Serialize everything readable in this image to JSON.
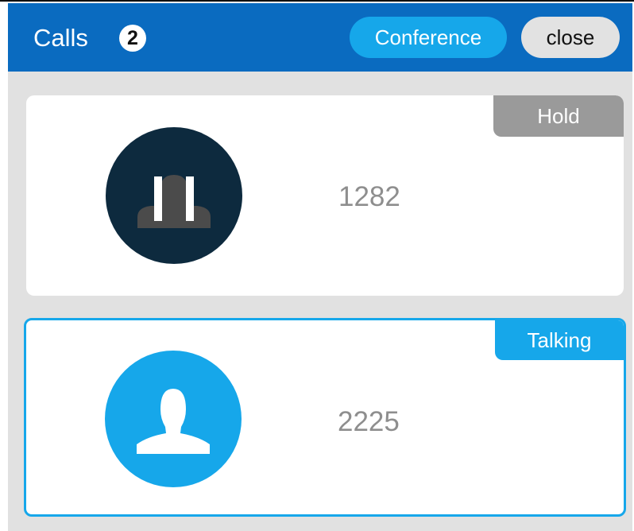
{
  "header": {
    "title": "Calls",
    "count": "2",
    "conference_label": "Conference",
    "close_label": "close"
  },
  "calls": [
    {
      "number": "1282",
      "status": "Hold",
      "status_color": "#9a9a9a",
      "avatar_icon": "paused-contact-icon"
    },
    {
      "number": "2225",
      "status": "Talking",
      "status_color": "#16a7ea",
      "avatar_icon": "person-icon"
    }
  ],
  "colors": {
    "header_bg": "#0a6bc0",
    "accent": "#16a7ea",
    "content_bg": "#e1e1e1",
    "hold_tag": "#9a9a9a",
    "number_text": "#8e8e8e"
  }
}
